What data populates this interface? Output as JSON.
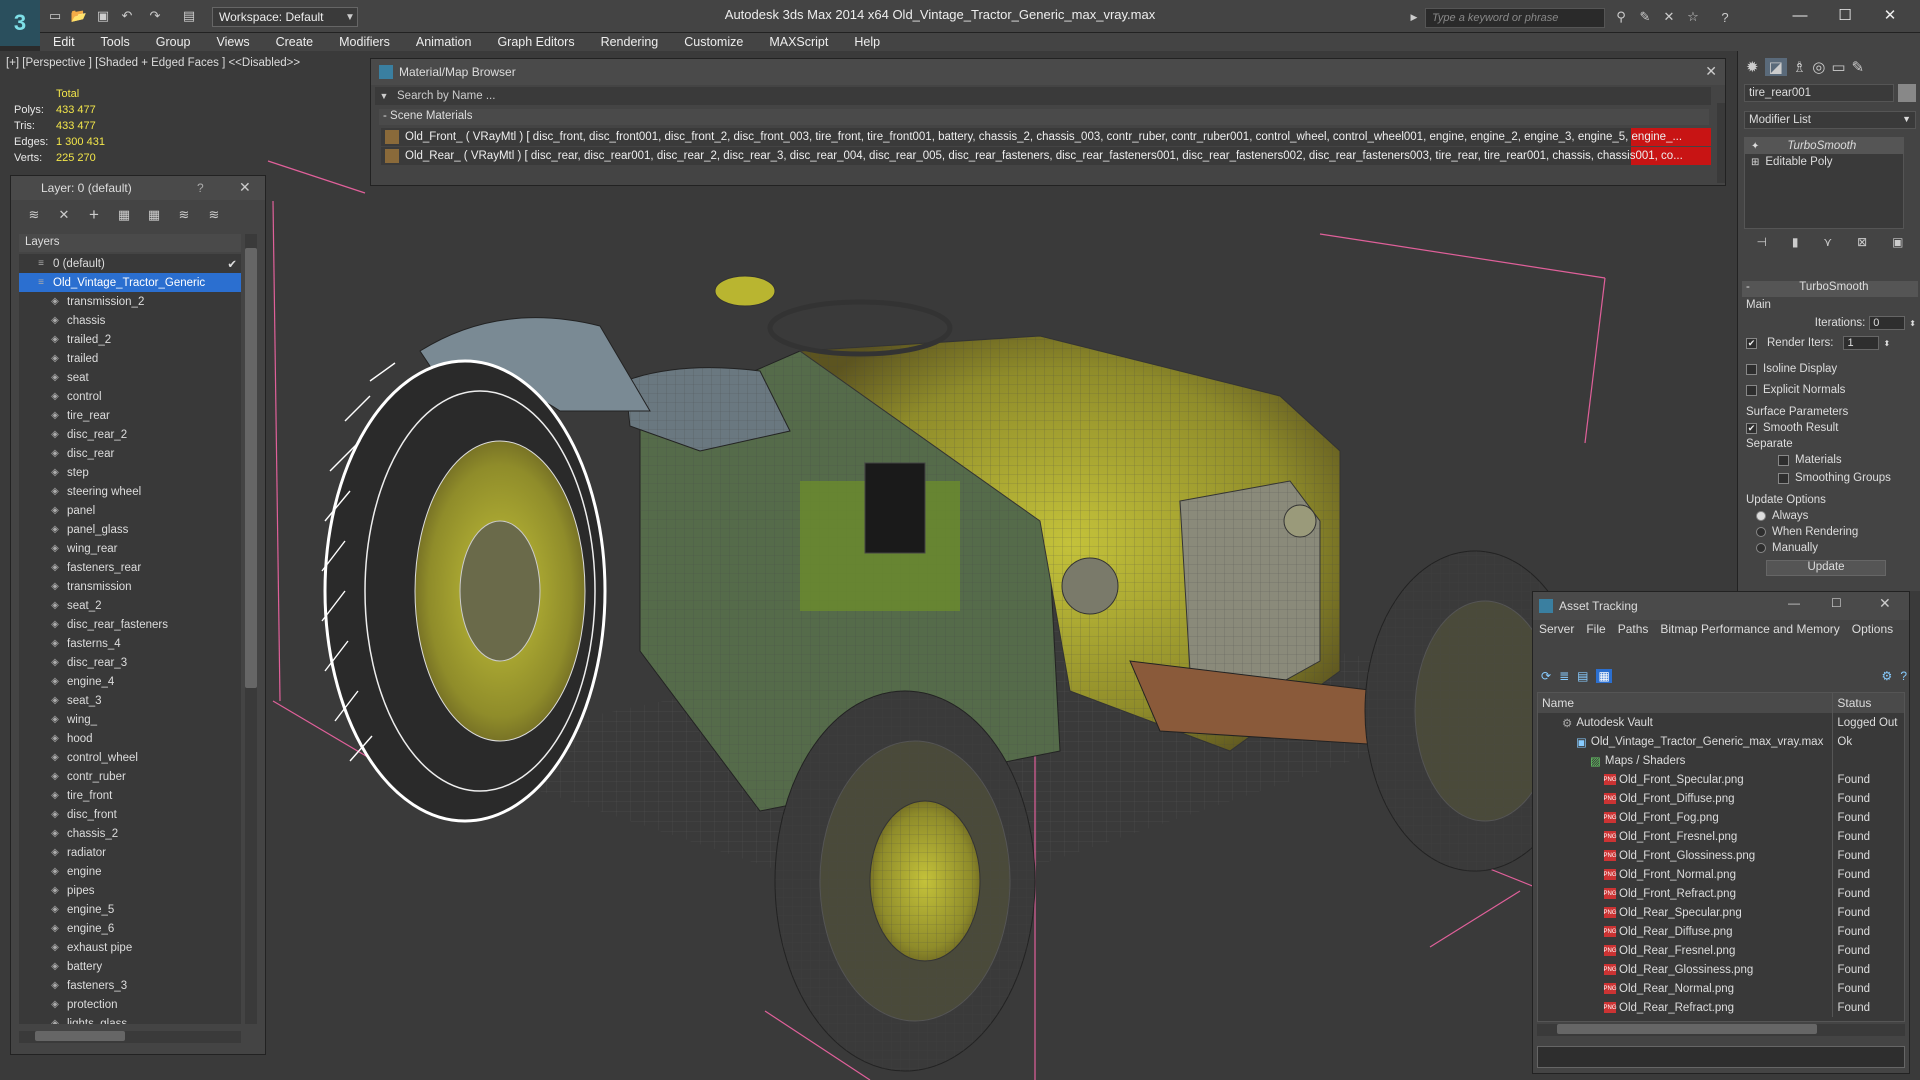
{
  "titlebar": {
    "app_title": "Autodesk 3ds Max  2014 x64      Old_Vintage_Tractor_Generic_max_vray.max",
    "workspace": "Workspace: Default",
    "search_placeholder": "Type a keyword or phrase"
  },
  "menu": [
    "Edit",
    "Tools",
    "Group",
    "Views",
    "Create",
    "Modifiers",
    "Animation",
    "Graph Editors",
    "Rendering",
    "Customize",
    "MAXScript",
    "Help"
  ],
  "viewport": {
    "label": "[+] [Perspective ] [Shaded + Edged Faces ]  <<Disabled>>",
    "stats_header": "Total",
    "stats": [
      {
        "k": "Polys:",
        "v": "433 477"
      },
      {
        "k": "Tris:",
        "v": "433 477"
      },
      {
        "k": "Edges:",
        "v": "1 300 431"
      },
      {
        "k": "Verts:",
        "v": "225 270"
      }
    ]
  },
  "layer_panel": {
    "title": "Layer: 0 (default)",
    "help": "?",
    "header": "Layers",
    "rows": [
      {
        "label": "0 (default)",
        "level": 0
      },
      {
        "label": "Old_Vintage_Tractor_Generic",
        "level": 0,
        "selected": true
      },
      {
        "label": "transmission_2",
        "level": 1
      },
      {
        "label": "chassis",
        "level": 1
      },
      {
        "label": "trailed_2",
        "level": 1
      },
      {
        "label": "trailed",
        "level": 1
      },
      {
        "label": "seat",
        "level": 1
      },
      {
        "label": "control",
        "level": 1
      },
      {
        "label": "tire_rear",
        "level": 1
      },
      {
        "label": "disc_rear_2",
        "level": 1
      },
      {
        "label": "disc_rear",
        "level": 1
      },
      {
        "label": "step",
        "level": 1
      },
      {
        "label": "steering wheel",
        "level": 1
      },
      {
        "label": "panel",
        "level": 1
      },
      {
        "label": "panel_glass",
        "level": 1
      },
      {
        "label": "wing_rear",
        "level": 1
      },
      {
        "label": "fasteners_rear",
        "level": 1
      },
      {
        "label": "transmission",
        "level": 1
      },
      {
        "label": "seat_2",
        "level": 1
      },
      {
        "label": "disc_rear_fasteners",
        "level": 1
      },
      {
        "label": "fasterns_4",
        "level": 1
      },
      {
        "label": "disc_rear_3",
        "level": 1
      },
      {
        "label": "engine_4",
        "level": 1
      },
      {
        "label": "seat_3",
        "level": 1
      },
      {
        "label": "wing_",
        "level": 1
      },
      {
        "label": "hood",
        "level": 1
      },
      {
        "label": "control_wheel",
        "level": 1
      },
      {
        "label": "contr_ruber",
        "level": 1
      },
      {
        "label": "tire_front",
        "level": 1
      },
      {
        "label": "disc_front",
        "level": 1
      },
      {
        "label": "chassis_2",
        "level": 1
      },
      {
        "label": "radiator",
        "level": 1
      },
      {
        "label": "engine",
        "level": 1
      },
      {
        "label": "pipes",
        "level": 1
      },
      {
        "label": "engine_5",
        "level": 1
      },
      {
        "label": "engine_6",
        "level": 1
      },
      {
        "label": "exhaust pipe",
        "level": 1
      },
      {
        "label": "battery",
        "level": 1
      },
      {
        "label": "fasteners_3",
        "level": 1
      },
      {
        "label": "protection",
        "level": 1
      },
      {
        "label": "lights_glass",
        "level": 1
      }
    ]
  },
  "material_browser": {
    "title": "Material/Map Browser",
    "search_placeholder": "Search by Name ...",
    "section": "- Scene Materials",
    "rows": [
      "Old_Front_  ( VRayMtl ) [ disc_front,  disc_front001,  disc_front_2,  disc_front_003,  tire_front,  tire_front001, battery, chassis_2, chassis_003, contr_ruber, contr_ruber001, control_wheel, control_wheel001, engine, engine_2, engine_3, engine_5, engine_...",
      "Old_Rear_  ( VRayMtl ) [ disc_rear,  disc_rear001,  disc_rear_2,  disc_rear_3,  disc_rear_004,  disc_rear_005,  disc_rear_fasteners,  disc_rear_fasteners001,  disc_rear_fasteners002,  disc_rear_fasteners003,  tire_rear,  tire_rear001,  chassis,  chassis001,  co..."
    ]
  },
  "command_panel": {
    "object_name": "tire_rear001",
    "modifier_list": "Modifier List",
    "stack": [
      "TurboSmooth",
      "Editable Poly"
    ],
    "rollout_title": "TurboSmooth",
    "main": "Main",
    "iterations_label": "Iterations:",
    "iterations": "0",
    "render_iters_label": "Render Iters:",
    "render_iters": "1",
    "isoline": "Isoline Display",
    "explicit_normals": "Explicit Normals",
    "surface_params": "Surface Parameters",
    "smooth_result": "Smooth Result",
    "separate": "Separate",
    "materials": "Materials",
    "smoothing_groups": "Smoothing Groups",
    "update_options": "Update Options",
    "always": "Always",
    "when_rendering": "When Rendering",
    "manually": "Manually",
    "update_button": "Update"
  },
  "asset_tracking": {
    "title": "Asset Tracking",
    "menu": [
      "Server",
      "File",
      "Paths",
      "Bitmap Performance and Memory",
      "Options"
    ],
    "col_name": "Name",
    "col_status": "Status",
    "rows": [
      {
        "name": "Autodesk Vault",
        "status": "Logged Out",
        "level": 0,
        "type": "vault"
      },
      {
        "name": "Old_Vintage_Tractor_Generic_max_vray.max",
        "status": "Ok",
        "level": 1,
        "type": "max"
      },
      {
        "name": "Maps / Shaders",
        "status": "",
        "level": 2,
        "type": "folder"
      },
      {
        "name": "Old_Front_Specular.png",
        "status": "Found",
        "level": 3,
        "type": "png"
      },
      {
        "name": "Old_Front_Diffuse.png",
        "status": "Found",
        "level": 3,
        "type": "png"
      },
      {
        "name": "Old_Front_Fog.png",
        "status": "Found",
        "level": 3,
        "type": "png"
      },
      {
        "name": "Old_Front_Fresnel.png",
        "status": "Found",
        "level": 3,
        "type": "png"
      },
      {
        "name": "Old_Front_Glossiness.png",
        "status": "Found",
        "level": 3,
        "type": "png"
      },
      {
        "name": "Old_Front_Normal.png",
        "status": "Found",
        "level": 3,
        "type": "png"
      },
      {
        "name": "Old_Front_Refract.png",
        "status": "Found",
        "level": 3,
        "type": "png"
      },
      {
        "name": "Old_Rear_Specular.png",
        "status": "Found",
        "level": 3,
        "type": "png"
      },
      {
        "name": "Old_Rear_Diffuse.png",
        "status": "Found",
        "level": 3,
        "type": "png"
      },
      {
        "name": "Old_Rear_Fresnel.png",
        "status": "Found",
        "level": 3,
        "type": "png"
      },
      {
        "name": "Old_Rear_Glossiness.png",
        "status": "Found",
        "level": 3,
        "type": "png"
      },
      {
        "name": "Old_Rear_Normal.png",
        "status": "Found",
        "level": 3,
        "type": "png"
      },
      {
        "name": "Old_Rear_Refract.png",
        "status": "Found",
        "level": 3,
        "type": "png"
      }
    ]
  },
  "colors": {
    "selection_blue": "#2b6fd0",
    "stats_yellow": "#f3e64a",
    "tractor_yellow": "#b9b530",
    "material_red": "#c81414"
  }
}
